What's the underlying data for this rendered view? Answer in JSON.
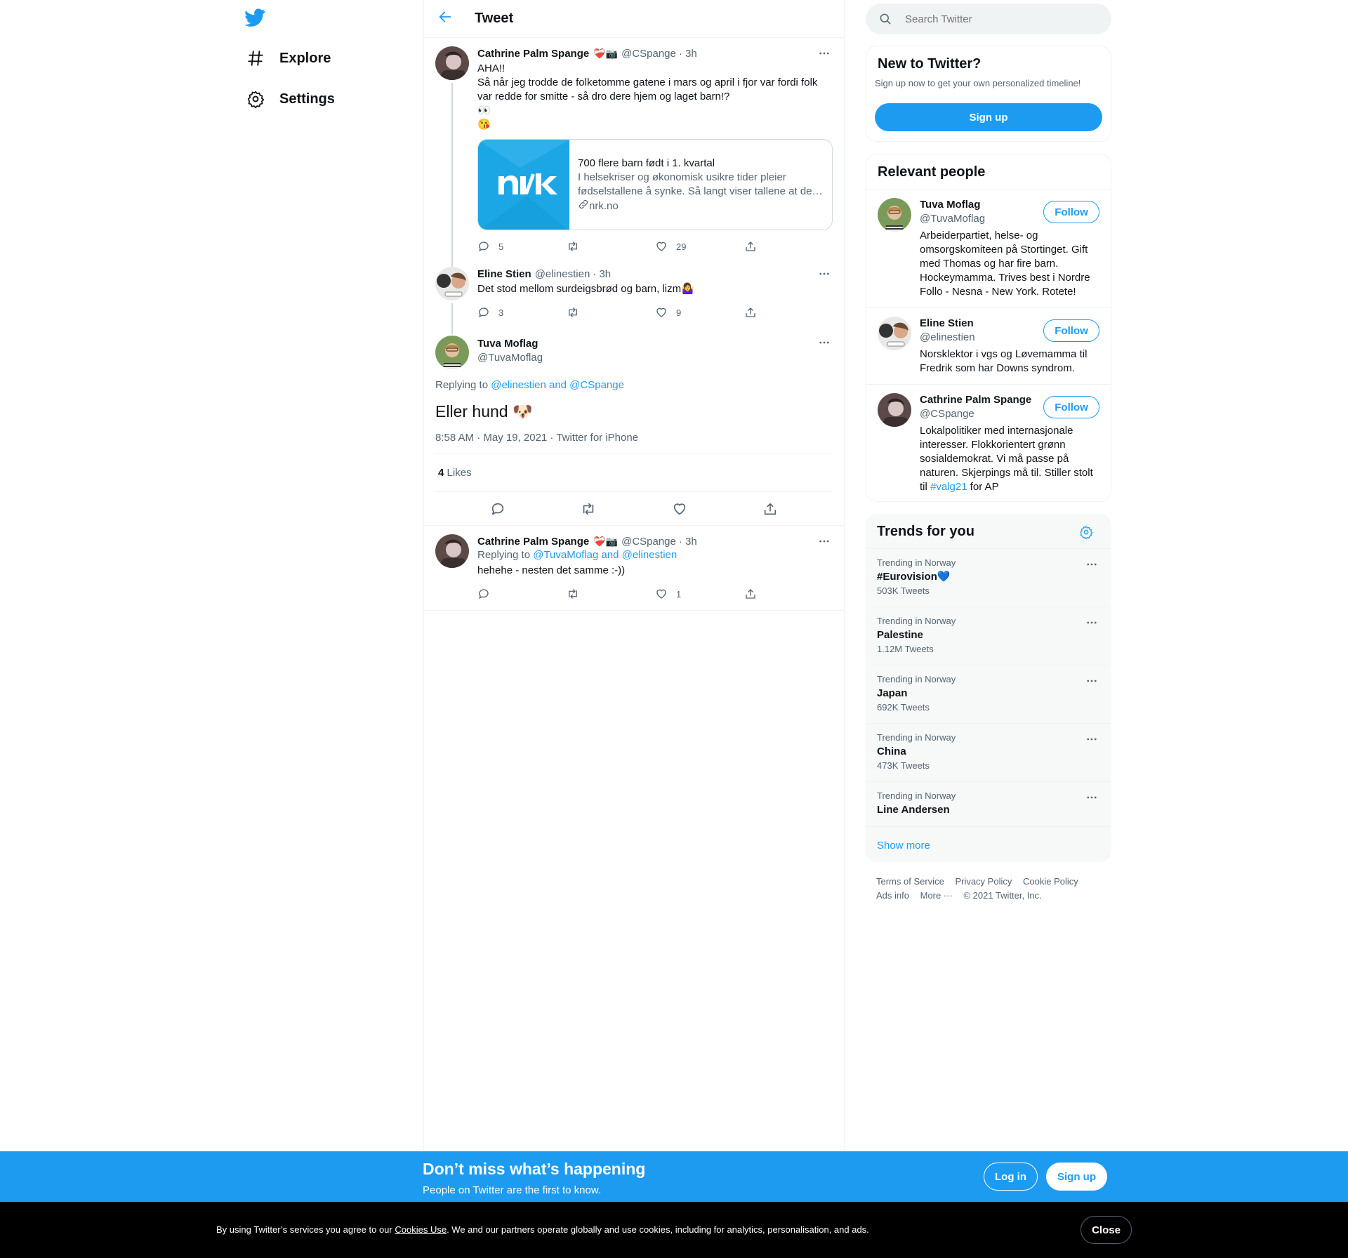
{
  "nav": {
    "explore_label": "Explore",
    "settings_label": "Settings"
  },
  "header": {
    "title": "Tweet"
  },
  "thread": [
    {
      "name": "Cathrine Palm Spange",
      "emoji": "❤️‍🩹📷",
      "handle": "@CSpange",
      "time": "· 3h",
      "text": "AHA!!\nSå når jeg trodde de folketomme gatene i mars og april i fjor var fordi folk var redde for smitte - så dro dere hjem og laget barn!?\n👀\n😘",
      "card": {
        "title": "700 flere barn født i 1. kvartal",
        "description": "I helsekriser og økonomisk usikre tider pleier fødselstallene å synke. Så langt viser tallene at de…",
        "domain": "nrk.no",
        "logo_text": "NRK"
      },
      "replies": "5",
      "retweets": "",
      "likes": "29"
    },
    {
      "name": "Eline Stien",
      "handle": "@elinestien",
      "time": "· 3h",
      "text": "Det stod mellom surdeigsbrød og barn, lizm🤷‍♀️",
      "replies": "3",
      "retweets": "",
      "likes": "9"
    }
  ],
  "focus": {
    "name": "Tuva Moflag",
    "handle": "@TuvaMoflag",
    "replying_prefix": "Replying to ",
    "replying_to": "@elinestien and @CSpange",
    "text": "Eller hund 🐶",
    "meta": "8:58 AM · May 19, 2021 · Twitter for iPhone",
    "likes_count": "4",
    "likes_label": "Likes"
  },
  "reply": {
    "name": "Cathrine Palm Spange",
    "emoji": "❤️‍🩹📷",
    "handle": "@CSpange",
    "time": "· 3h",
    "replying_prefix": "Replying to ",
    "replying_to": "@TuvaMoflag and @elinestien",
    "text": "hehehe - nesten det samme :-))",
    "replies": "",
    "retweets": "",
    "likes": "1"
  },
  "search": {
    "placeholder": "Search Twitter"
  },
  "new_to_twitter": {
    "title": "New to Twitter?",
    "subtitle": "Sign up now to get your own personalized timeline!",
    "button": "Sign up"
  },
  "relevant": {
    "title": "Relevant people",
    "follow_label": "Follow",
    "people": [
      {
        "name": "Tuva Moflag",
        "handle": "@TuvaMoflag",
        "bio": "Arbeiderpartiet, helse- og omsorgskomiteen på Stortinget. Gift med Thomas og har fire barn. Hockeymamma. Trives best i Nordre Follo - Nesna - New York. Rotete!"
      },
      {
        "name": "Eline Stien",
        "handle": "@elinestien",
        "bio": "Norsklektor i vgs og Løvemamma til Fredrik som har Downs syndrom."
      },
      {
        "name": "Cathrine Palm Spange",
        "handle": "@CSpange",
        "bio": "Lokalpolitiker med internasjonale interesser. Flokkorientert grønn sosialdemokrat. Vi må passe på naturen. Skjerpings må til. Stiller stolt til ",
        "bio_tag": "#valg21",
        "bio_end": " for AP"
      }
    ]
  },
  "trends": {
    "title": "Trends for you",
    "items": [
      {
        "context": "Trending in Norway",
        "name": "#Eurovision💙",
        "count": "503K Tweets"
      },
      {
        "context": "Trending in Norway",
        "name": "Palestine",
        "count": "1.12M Tweets"
      },
      {
        "context": "Trending in Norway",
        "name": "Japan",
        "count": "692K Tweets"
      },
      {
        "context": "Trending in Norway",
        "name": "China",
        "count": "473K Tweets"
      },
      {
        "context": "Trending in Norway",
        "name": "Line Andersen",
        "count": ""
      }
    ],
    "show_more": "Show more"
  },
  "footer": {
    "terms": "Terms of Service",
    "privacy": "Privacy Policy",
    "cookie": "Cookie Policy",
    "ads": "Ads info",
    "more": "More ···",
    "copyright": "© 2021 Twitter, Inc."
  },
  "signup_bar": {
    "title": "Don’t miss what’s happening",
    "subtitle": "People on Twitter are the first to know.",
    "login": "Log in",
    "signup": "Sign up"
  },
  "cookie_bar": {
    "text_before": "By using Twitter’s services you agree to our ",
    "link": "Cookies Use",
    "text_after": ". We and our partners operate globally and use cookies, including for analytics, personalisation, and ads.",
    "close": "Close"
  },
  "colors": {
    "accent": "#1d9bf0",
    "text": "#0f1419",
    "secondary": "#536471",
    "nrk": "#1ba7e6"
  }
}
